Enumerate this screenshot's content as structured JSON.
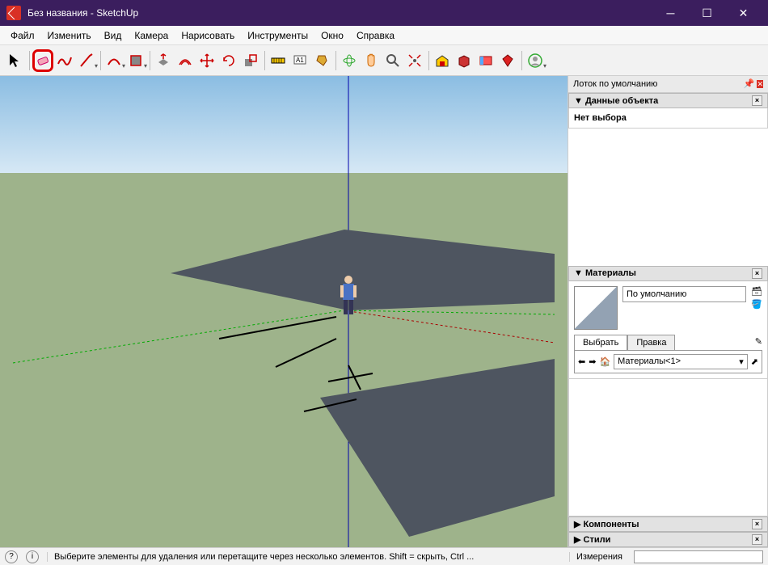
{
  "window": {
    "title": "Без названия - SketchUp"
  },
  "menubar": {
    "file": "Файл",
    "edit": "Изменить",
    "view": "Вид",
    "camera": "Камера",
    "draw": "Нарисовать",
    "tools": "Инструменты",
    "window": "Окно",
    "help": "Справка"
  },
  "tray": {
    "title": "Лоток по умолчанию",
    "entity": {
      "title": "▼ Данные объекта",
      "nosel": "Нет выбора"
    },
    "materials": {
      "title": "▼ Материалы",
      "name": "По умолчанию",
      "tab_select": "Выбрать",
      "tab_edit": "Правка",
      "combo": "Материалы<1>"
    },
    "components": {
      "title": "▶ Компоненты"
    },
    "styles": {
      "title": "▶ Стили"
    }
  },
  "statusbar": {
    "hint": "Выберите элементы для удаления или перетащите через несколько элементов. Shift = скрыть, Ctrl ...",
    "measure_label": "Измерения"
  }
}
